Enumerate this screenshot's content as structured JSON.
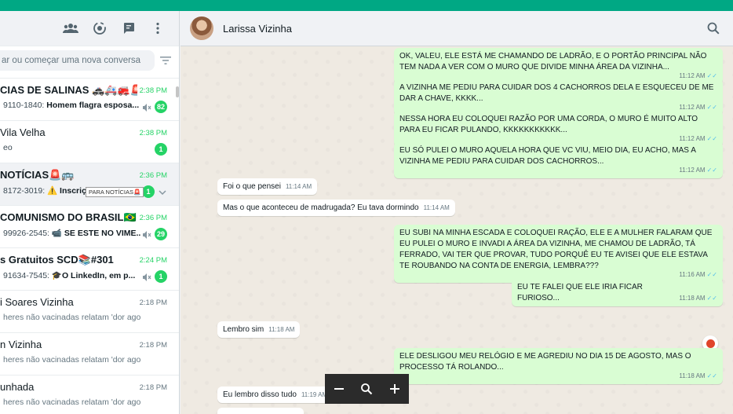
{
  "left": {
    "search_placeholder": "ar ou começar uma nova conversa",
    "chats": [
      {
        "name": "CIAS DE SALINAS 🚓🚑🚒🚨🚔",
        "time": "2:38 PM",
        "preview_sender": "9110-1840:",
        "preview_text": " Homem flagra esposa...",
        "muted": true,
        "badge": "82"
      },
      {
        "name": "Vila Velha",
        "time": "2:38 PM",
        "preview_sender": "",
        "preview_text": "eo",
        "muted": false,
        "badge": "1"
      },
      {
        "name": "NOTÍCIAS🚨🚌",
        "time": "2:36 PM",
        "preview_sender": "8172-3019:",
        "preview_text": " ⚠️ Inscrições par...",
        "muted": true,
        "badge": "1",
        "tooltip": "PARA NOTÍCIAS🚨"
      },
      {
        "name": " COMUNISMO DO BRASIL🇧🇷",
        "time": "2:36 PM",
        "preview_sender": "99926-2545:",
        "preview_text": " 📹 SE ESTE NO VIME...",
        "muted": true,
        "badge": "29"
      },
      {
        "name": "s Gratuitos SCD📚#301",
        "time": "2:24 PM",
        "preview_sender": "91634-7545:",
        "preview_text": " 🎓O LinkedIn, em p...",
        "muted": true,
        "badge": "1"
      },
      {
        "name": "i Soares Vizinha",
        "time": "2:18 PM",
        "preview_sender": "",
        "preview_text": "heres não vacinadas relatam 'dor agonizant...",
        "muted": false,
        "badge": ""
      },
      {
        "name": "n Vizinha",
        "time": "2:18 PM",
        "preview_sender": "",
        "preview_text": "heres não vacinadas relatam 'dor agonizant...",
        "muted": false,
        "badge": ""
      },
      {
        "name": "unhada",
        "time": "2:18 PM",
        "preview_sender": "",
        "preview_text": "heres não vacinadas relatam 'dor agonizant...",
        "muted": false,
        "badge": ""
      }
    ]
  },
  "chat": {
    "contact_name": "Larissa Vizinha",
    "messages": [
      {
        "dir": "out",
        "text": "OK, VALEU, ELE ESTÁ ME CHAMANDO DE LADRÃO, E O PORTÃO PRINCIPAL NÃO TEM NADA A VER COM O MURO QUE DIVIDE MINHA ÁREA DA VIZINHA...",
        "time": "11:12 AM"
      },
      {
        "dir": "out",
        "text": "A VIZINHA ME PEDIU PARA CUIDAR DOS 4 CACHORROS DELA E ESQUECEU DE ME DAR A CHAVE, KKKK...",
        "time": "11:12 AM"
      },
      {
        "dir": "out",
        "text": "NESSA HORA EU COLOQUEI RAZÃO POR UMA CORDA, O MURO É MUITO ALTO PARA EU FICAR PULANDO, KKKKKKKKKKK...",
        "time": "11:12 AM"
      },
      {
        "dir": "out",
        "text": "EU SÓ PULEI O MURO AQUELA HORA QUE VC VIU, MEIO DIA, EU  ACHO, MAS A VIZINHA ME PEDIU PARA CUIDAR DOS CACHORROS...",
        "time": "11:12 AM"
      },
      {
        "dir": "in",
        "text": "Foi o que pensei",
        "time": "11:14 AM"
      },
      {
        "dir": "in",
        "text": "Mas o que aconteceu de madrugada? Eu tava dormindo",
        "time": "11:14 AM"
      },
      {
        "dir": "out",
        "text": "EU SUBI NA MINHA ESCADA E COLOQUEI RAÇÃO, ELE E A MULHER FALARAM QUE EU PULEI O MURO E INVADI A ÁREA DA VIZINHA, ME CHAMOU DE LADRÃO, TÁ FERRADO, VAI TER QUE PROVAR, TUDO PORQUÊ EU TE AVISEI QUE ELE ESTAVA TE ROUBANDO NA CONTA DE ENERGIA, LEMBRA???",
        "time": "11:16 AM"
      },
      {
        "dir": "out",
        "text": "EU TE FALEI QUE ELE IRIA FICAR FURIOSO...",
        "time": "11:18 AM"
      },
      {
        "dir": "in",
        "text": "Lembro sim",
        "time": "11:18 AM"
      },
      {
        "dir": "out",
        "text": "ELE DESLIGOU MEU RELÓGIO E ME AGREDIU NO DIA 15 DE AGOSTO, MAS O PROCESSO TÁ ROLANDO...",
        "time": "11:18 AM"
      },
      {
        "dir": "in",
        "text": "Eu lembro disso tudo",
        "time": "11:19 AM"
      }
    ]
  },
  "colors": {
    "accent": "#00a884",
    "outgoing": "#d9fdd3",
    "unread": "#25d366",
    "ticks": "#53bdeb"
  },
  "icons": [
    "community-icon",
    "status-icon",
    "new-chat-icon",
    "menu-icon",
    "filter-icon",
    "mute-icon",
    "chevron-down-icon",
    "search-icon",
    "zoom-out-icon",
    "zoom-icon",
    "zoom-in-icon"
  ]
}
